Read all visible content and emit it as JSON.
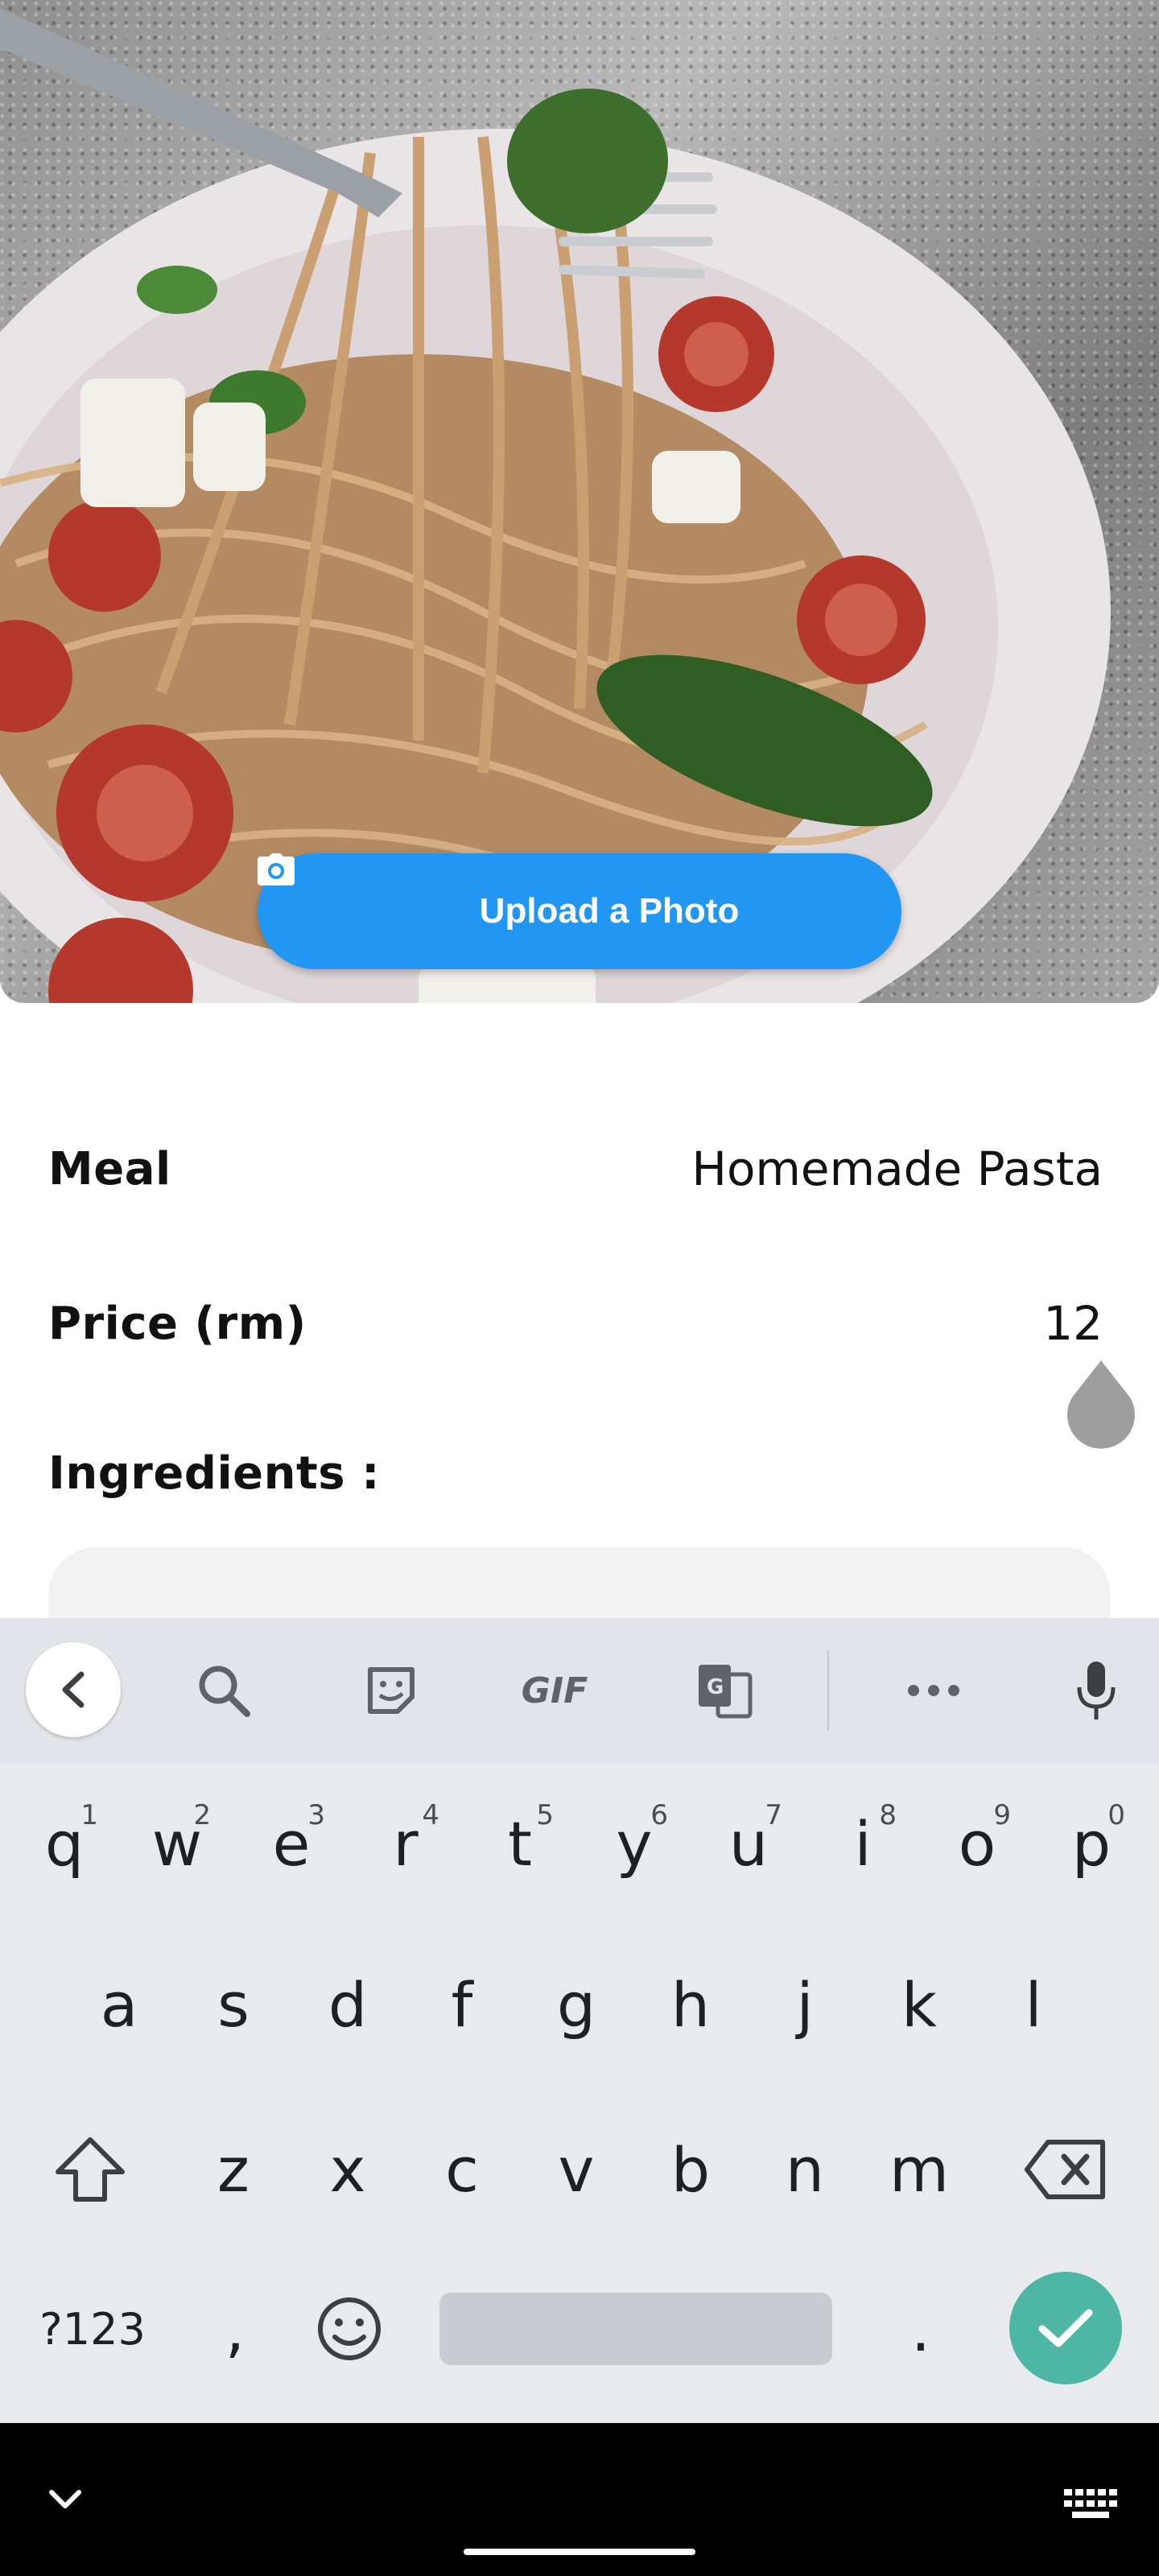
{
  "hero": {
    "image_description_icon": "pasta-photo",
    "upload_button": {
      "label": "Upload a Photo",
      "icon": "camera-icon"
    }
  },
  "form": {
    "meal": {
      "label": "Meal",
      "value": "Homemade Pasta"
    },
    "price": {
      "label": "Price (rm)",
      "value": "12"
    },
    "ingredients": {
      "label": "Ingredients :"
    }
  },
  "keyboard": {
    "toolbar_icons": [
      "back-icon",
      "search-icon",
      "sticker-icon",
      "gif-icon",
      "translate-icon",
      "more-icon",
      "mic-icon"
    ],
    "gif_label": "GIF",
    "row1": [
      {
        "char": "q",
        "hint": "1"
      },
      {
        "char": "w",
        "hint": "2"
      },
      {
        "char": "e",
        "hint": "3"
      },
      {
        "char": "r",
        "hint": "4"
      },
      {
        "char": "t",
        "hint": "5"
      },
      {
        "char": "y",
        "hint": "6"
      },
      {
        "char": "u",
        "hint": "7"
      },
      {
        "char": "i",
        "hint": "8"
      },
      {
        "char": "o",
        "hint": "9"
      },
      {
        "char": "p",
        "hint": "0"
      }
    ],
    "row2": [
      "a",
      "s",
      "d",
      "f",
      "g",
      "h",
      "j",
      "k",
      "l"
    ],
    "row3": [
      "z",
      "x",
      "c",
      "v",
      "b",
      "n",
      "m"
    ],
    "symbols_label": "?123",
    "comma": ",",
    "period": ".",
    "accent_color": "#4db6a5"
  },
  "colors": {
    "upload_button": "#2196f3",
    "keyboard_bg": "#e8eaed"
  }
}
